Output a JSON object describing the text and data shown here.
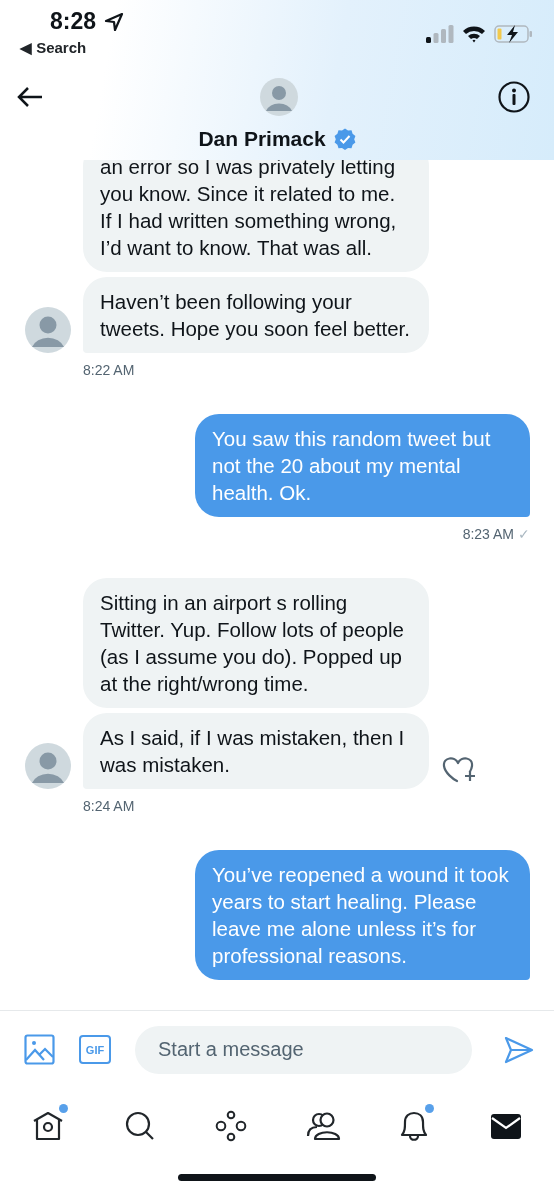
{
  "status_bar": {
    "time": "8:28",
    "back_link": "◀ Search"
  },
  "header": {
    "name": "Dan Primack",
    "verified": true
  },
  "groups": [
    {
      "kind": "received",
      "bubbles": [
        {
          "text": "an error so I was privately letting you know. Since it related to me. If I had written something wrong, I’d want to know. That was all.",
          "like_button": false
        },
        {
          "text": "Haven’t been following your tweets. Hope you soon feel better.",
          "like_button": false
        }
      ],
      "time": "8:22 AM"
    },
    {
      "kind": "sent",
      "bubbles": [
        {
          "text": "You saw this random tweet but not the 20 about my mental health. Ok.",
          "like_button": false
        }
      ],
      "time": "8:23 AM",
      "receipt": "✓"
    },
    {
      "kind": "received",
      "bubbles": [
        {
          "text": "Sitting in an airport s rolling Twitter. Yup. Follow lots of people (as I assume you do). Popped up at the right/wrong time.",
          "like_button": false
        },
        {
          "text": "As I said, if I was mistaken, then I was mistaken.",
          "like_button": true
        }
      ],
      "time": "8:24 AM"
    },
    {
      "kind": "sent",
      "bubbles": [
        {
          "text": "You’ve reopened a wound it took years to start healing. Please leave me alone unless it’s for professional reasons.",
          "like_button": false
        }
      ]
    }
  ],
  "composer": {
    "gif_label": "GIF",
    "placeholder": "Start a message"
  },
  "nav": [
    {
      "kind": "home",
      "badge": true,
      "selected": false
    },
    {
      "kind": "search",
      "badge": false,
      "selected": false
    },
    {
      "kind": "spaces",
      "badge": false,
      "selected": false
    },
    {
      "kind": "communities",
      "badge": false,
      "selected": false
    },
    {
      "kind": "notifications",
      "badge": true,
      "selected": false
    },
    {
      "kind": "messages",
      "badge": false,
      "selected": true
    }
  ]
}
